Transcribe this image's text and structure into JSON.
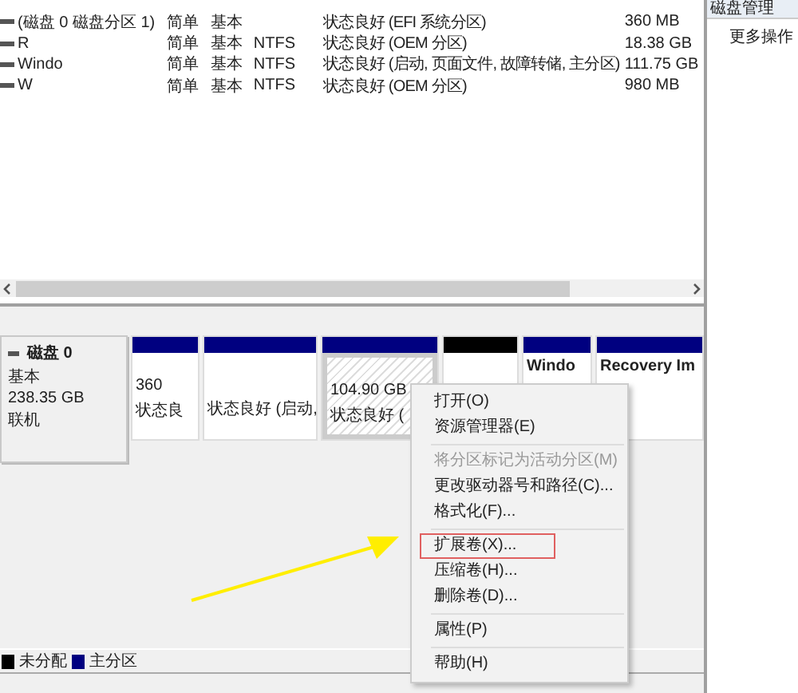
{
  "volumes": [
    {
      "name": "(磁盘 0 磁盘分区 1)",
      "layout": "简单",
      "type": "基本",
      "status": "状态良好 (EFI 系统分区)",
      "capacity": "360 MB"
    },
    {
      "name": "R",
      "layout": "简单",
      "type": "基本",
      "fs": "NTFS",
      "status": "状态良好 (OEM 分区)",
      "capacity": "18.38 GB"
    },
    {
      "name": "Windo",
      "layout": "简单",
      "type": "基本",
      "fs": "NTFS",
      "status": "状态良好 (启动, 页面文件, 故障转储, 主分区)",
      "capacity": "111.75 GB"
    },
    {
      "name": "W",
      "layout": "简单",
      "type": "基本",
      "fs": "NTFS",
      "status": "状态良好 (OEM 分区)",
      "capacity": "980 MB"
    }
  ],
  "actions": {
    "header": "磁盘管理",
    "items": [
      "更多操作"
    ]
  },
  "disk": {
    "name": "磁盘 0",
    "type": "基本",
    "size": "238.35 GB",
    "state": "联机",
    "partitions": [
      {
        "color": "#000080",
        "selected": false,
        "lines": [
          "360",
          "状态良"
        ]
      },
      {
        "color": "#000080",
        "selected": false,
        "lines": [
          "状态良好 (启动,"
        ]
      },
      {
        "color": "#000080",
        "selected": true,
        "lines": [
          "104.90 GB",
          "状态良好 ("
        ]
      },
      {
        "color": "#000000",
        "selected": false
      },
      {
        "color": "#000080",
        "selected": false,
        "title": "Windo"
      },
      {
        "color": "#000080",
        "selected": false,
        "title": "Recovery Im"
      }
    ]
  },
  "context_menu": [
    {
      "kind": "item",
      "label": "打开(O)",
      "disabled": false,
      "highlighted": false
    },
    {
      "kind": "item",
      "label": "资源管理器(E)",
      "disabled": false,
      "highlighted": false
    },
    {
      "kind": "separator"
    },
    {
      "kind": "item",
      "label": "将分区标记为活动分区(M)",
      "disabled": true,
      "highlighted": false
    },
    {
      "kind": "item",
      "label": "更改驱动器号和路径(C)...",
      "disabled": false,
      "highlighted": false
    },
    {
      "kind": "item",
      "label": "格式化(F)...",
      "disabled": false,
      "highlighted": false
    },
    {
      "kind": "separator"
    },
    {
      "kind": "item",
      "label": "扩展卷(X)...",
      "disabled": false,
      "highlighted": true
    },
    {
      "kind": "item",
      "label": "压缩卷(H)...",
      "disabled": false,
      "highlighted": false
    },
    {
      "kind": "item",
      "label": "删除卷(D)...",
      "disabled": false,
      "highlighted": false
    },
    {
      "kind": "separator"
    },
    {
      "kind": "item",
      "label": "属性(P)",
      "disabled": false,
      "highlighted": false
    },
    {
      "kind": "separator"
    },
    {
      "kind": "item",
      "label": "帮助(H)",
      "disabled": false,
      "highlighted": false
    }
  ],
  "legend": [
    {
      "label": "未分配",
      "color": "#000000"
    },
    {
      "label": "主分区",
      "color": "#000080"
    }
  ]
}
